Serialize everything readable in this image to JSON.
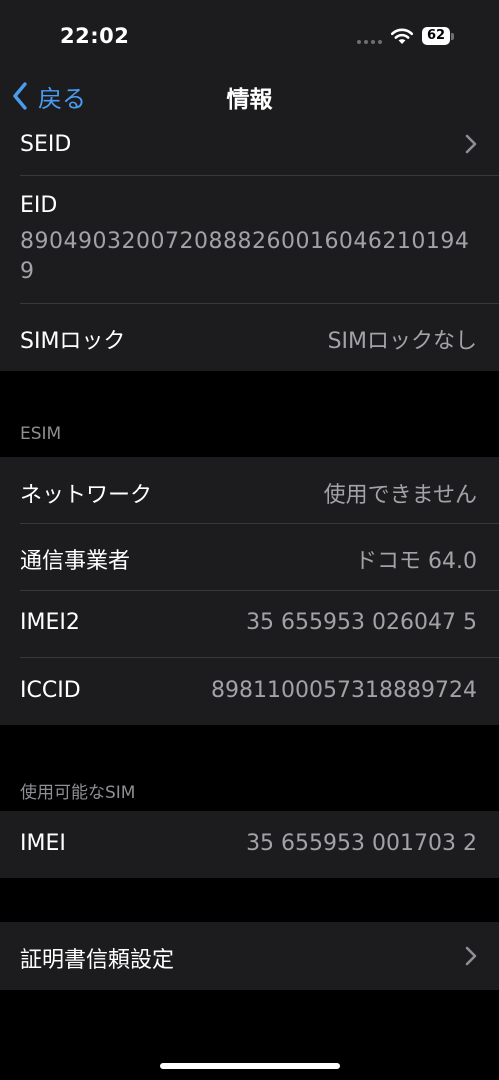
{
  "status_bar": {
    "time": "22:02",
    "battery": "62"
  },
  "nav": {
    "back_label": "戻る",
    "title": "情報"
  },
  "group1": {
    "seid_label": "SEID",
    "eid_label": "EID",
    "eid_value": "89049032007208882600160462101949",
    "sim_lock_label": "SIMロック",
    "sim_lock_value": "SIMロックなし"
  },
  "esim": {
    "header": "ESIM",
    "network_label": "ネットワーク",
    "network_value": "使用できません",
    "carrier_label": "通信事業者",
    "carrier_value": "ドコモ 64.0",
    "imei2_label": "IMEI2",
    "imei2_value": "35 655953 026047 5",
    "iccid_label": "ICCID",
    "iccid_value": "8981100057318889724"
  },
  "available_sim": {
    "header": "使用可能なSIM",
    "imei_label": "IMEI",
    "imei_value": "35 655953 001703 2"
  },
  "certificate": {
    "label": "証明書信頼設定"
  },
  "colors": {
    "accent": "#4a9cf1",
    "background": "#000000",
    "cell": "#1c1c1e",
    "secondary_text": "#a2a2a7"
  }
}
